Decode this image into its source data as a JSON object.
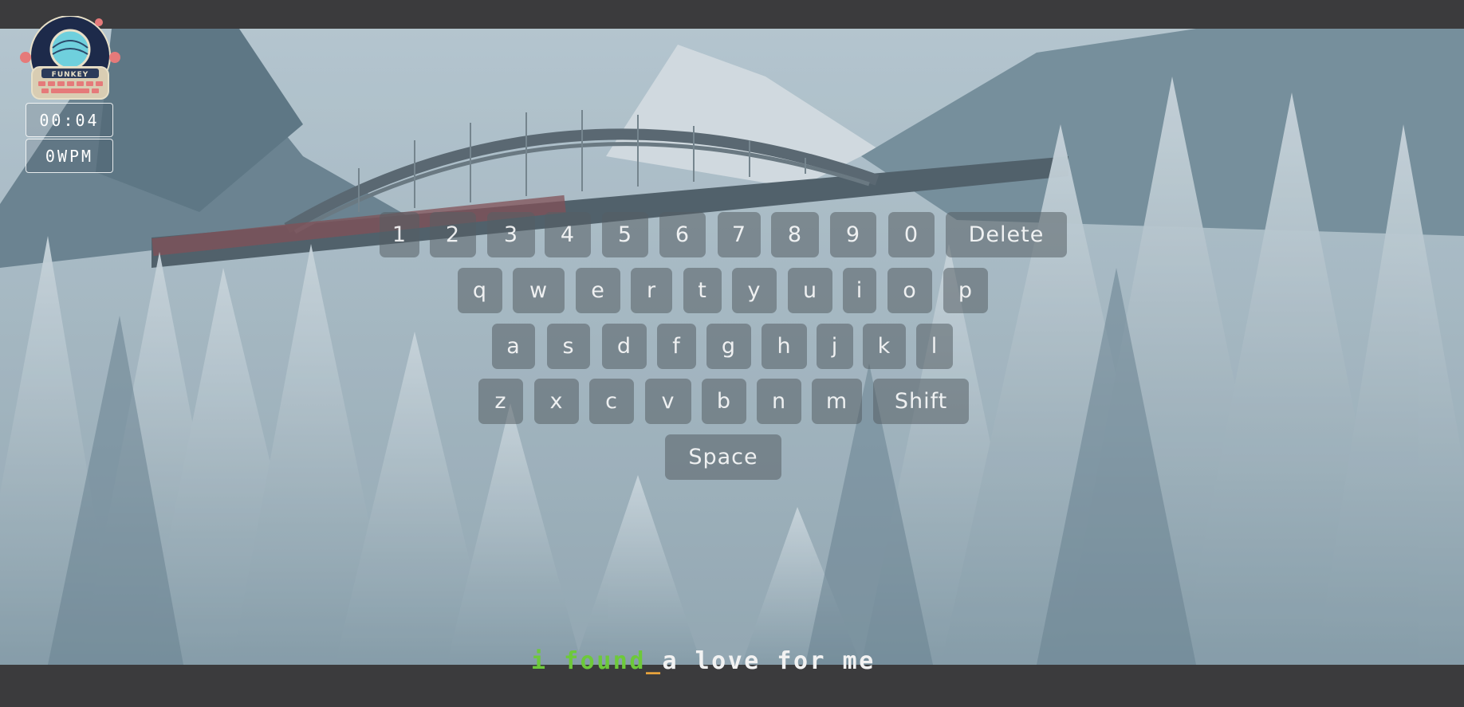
{
  "app": {
    "logo_text": "FUNKEY"
  },
  "stats": {
    "timer": "00:04",
    "wpm": "0WPM"
  },
  "keyboard": {
    "row1": [
      "1",
      "2",
      "3",
      "4",
      "5",
      "6",
      "7",
      "8",
      "9",
      "0",
      "Delete"
    ],
    "row2": [
      "q",
      "w",
      "e",
      "r",
      "t",
      "y",
      "u",
      "i",
      "o",
      "p"
    ],
    "row3": [
      "a",
      "s",
      "d",
      "f",
      "g",
      "h",
      "j",
      "k",
      "l"
    ],
    "row4": [
      "z",
      "x",
      "c",
      "v",
      "b",
      "n",
      "m",
      "Shift"
    ],
    "row5": [
      "Space"
    ]
  },
  "typing": {
    "typed": "i found",
    "cursor": "_",
    "remaining": "a love for me"
  },
  "colors": {
    "typed": "#6dc93a",
    "cursor": "#e6a23c",
    "remaining": "#f2f2f2",
    "frame": "#3b3b3d"
  }
}
